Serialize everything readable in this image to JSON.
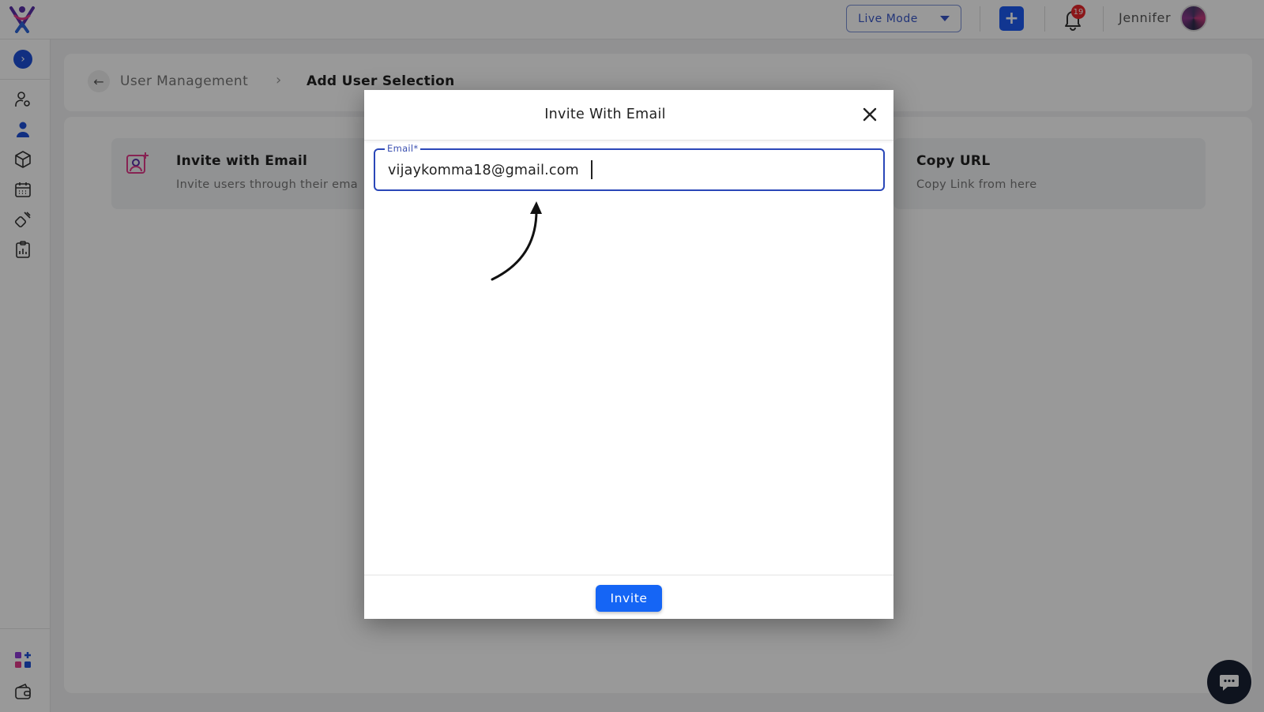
{
  "topbar": {
    "mode_label": "Live Mode",
    "add_label": "+",
    "notification_count": "19",
    "user_name": "Jennifer"
  },
  "sidebar": {
    "toggle_glyph": "›",
    "items": [
      {
        "icon": "user-settings-icon"
      },
      {
        "icon": "user-icon"
      },
      {
        "icon": "cube-icon"
      },
      {
        "icon": "calendar-icon"
      },
      {
        "icon": "integrations-icon"
      },
      {
        "icon": "report-clipboard-icon"
      }
    ],
    "bottom_items": [
      {
        "icon": "apps-add-icon"
      },
      {
        "icon": "wallet-icon"
      }
    ]
  },
  "breadcrumb": {
    "back_glyph": "←",
    "parent": "User Management",
    "separator": "›",
    "current": "Add User Selection"
  },
  "options": [
    {
      "title": "Invite with Email",
      "description": "Invite users through their ema",
      "icon": "invite-user-icon"
    },
    {
      "title": "Copy URL",
      "description": "Copy Link from here",
      "icon": "link-icon"
    }
  ],
  "modal": {
    "title": "Invite With Email",
    "email_label": "Email*",
    "email_value": "vijaykomma18@gmail.com",
    "invite_label": "Invite"
  },
  "colors": {
    "primary": "#1565f5",
    "accent_border": "#2a47b8",
    "badge": "#e8262b",
    "chat_fab": "#182033"
  }
}
